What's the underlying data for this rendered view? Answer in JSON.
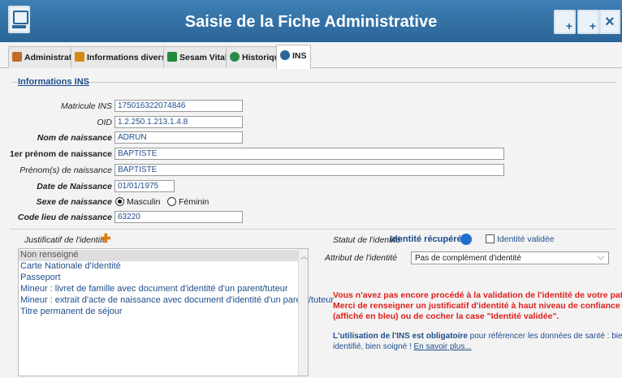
{
  "window": {
    "title": "Saisie de la Fiche Administrative",
    "buttons": {
      "new_doc_icon": "new-document-icon",
      "add_doc_icon": "add-document-icon",
      "close_glyph": "×"
    }
  },
  "tabs": [
    {
      "label": "Administratif",
      "icon": "person-icon",
      "color": "#c06a2a"
    },
    {
      "label": "Informations diverses",
      "icon": "info-icon",
      "color": "#d48a10"
    },
    {
      "label": "Sesam Vitale",
      "icon": "card-icon",
      "color": "#1f8a3a"
    },
    {
      "label": "Historique",
      "icon": "history-icon",
      "color": "#2a8a4a"
    },
    {
      "label": "INS",
      "icon": "ins-icon",
      "color": "#2b6598",
      "active": true
    }
  ],
  "ins": {
    "group_title": "Informations INS",
    "matricule": {
      "label": "Matricule INS",
      "value": "175016322074846"
    },
    "oid": {
      "label": "OID",
      "value": "1.2.250.1.213.1.4.8"
    },
    "nom": {
      "label": "Nom de naissance",
      "value": "ADRUN"
    },
    "prenom1": {
      "label": "1er prénom de naissance",
      "value": "BAPTISTE"
    },
    "prenoms": {
      "label": "Prénom(s) de naissance",
      "value": "BAPTISTE"
    },
    "date": {
      "label": "Date de Naissance",
      "value": "01/01/1975"
    },
    "sexe": {
      "label": "Sexe de naissance",
      "options": [
        "Masculin",
        "Féminin"
      ],
      "selected": "Masculin"
    },
    "lieu": {
      "label": "Code lieu de naissance",
      "value": "63220"
    }
  },
  "justificatif": {
    "label": "Justificatif de l'identité",
    "add_glyph": "✚",
    "items": [
      "Non renseigné",
      "Carte Nationale d'Identité",
      "Passeport",
      "Mineur : livret de famille avec document d'identité d'un parent/tuteur",
      "Mineur : extrait d'acte de naissance avec document d'identité d'un parent/tuteur",
      "Titre permanent de séjour"
    ],
    "selected_index": 0
  },
  "statut": {
    "label": "Statut de l'identité",
    "value": "Identité récupérée",
    "dot_color": "#1f6fd1",
    "checkbox_label": "Identité validée",
    "checked": false
  },
  "attribut": {
    "label": "Attribut de l'identité",
    "value": "Pas de complément d'identité"
  },
  "messages": {
    "warn_lines": [
      "Vous n'avez pas encore procédé à la validation de l'identité de votre patient.",
      "Merci de renseigner un justificatif d'identité à haut niveau de confiance",
      "(affiché en bleu) ou de cocher la case \"Identité validée\"."
    ],
    "info_bold": "L'utilisation de l'INS est obligatoire",
    "info_rest": " pour référencer les données de santé :  bien",
    "info_line2": "identifié, bien soigné !",
    "info_link": "En savoir plus..."
  }
}
